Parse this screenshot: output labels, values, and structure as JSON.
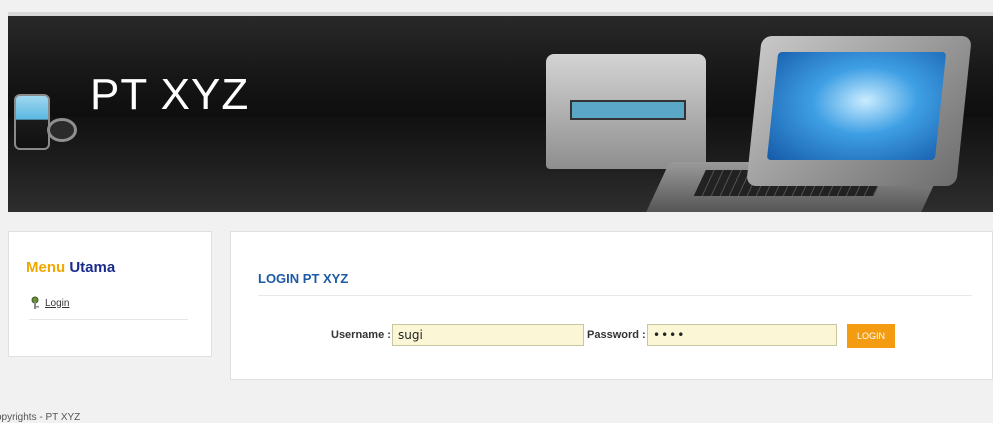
{
  "header": {
    "title": "PT XYZ",
    "logo_icon": "pt-xyz-logo-icon"
  },
  "sidebar": {
    "title_word1": "Menu",
    "title_word2": "Utama",
    "items": [
      {
        "label": "Login",
        "icon": "key-icon"
      }
    ]
  },
  "login": {
    "title": "LOGIN PT XYZ",
    "username_label": "Username :",
    "username_value": "sugi",
    "password_label": "Password :",
    "password_value": "••••",
    "button_label": "LOGIN"
  },
  "footer": {
    "text": "opyrights - PT XYZ"
  },
  "colors": {
    "accent_orange": "#f39c12",
    "menu_orange": "#f0a800",
    "menu_blue": "#1a2b8c",
    "title_blue": "#1c5aa6",
    "input_bg": "#fbf7d6"
  }
}
